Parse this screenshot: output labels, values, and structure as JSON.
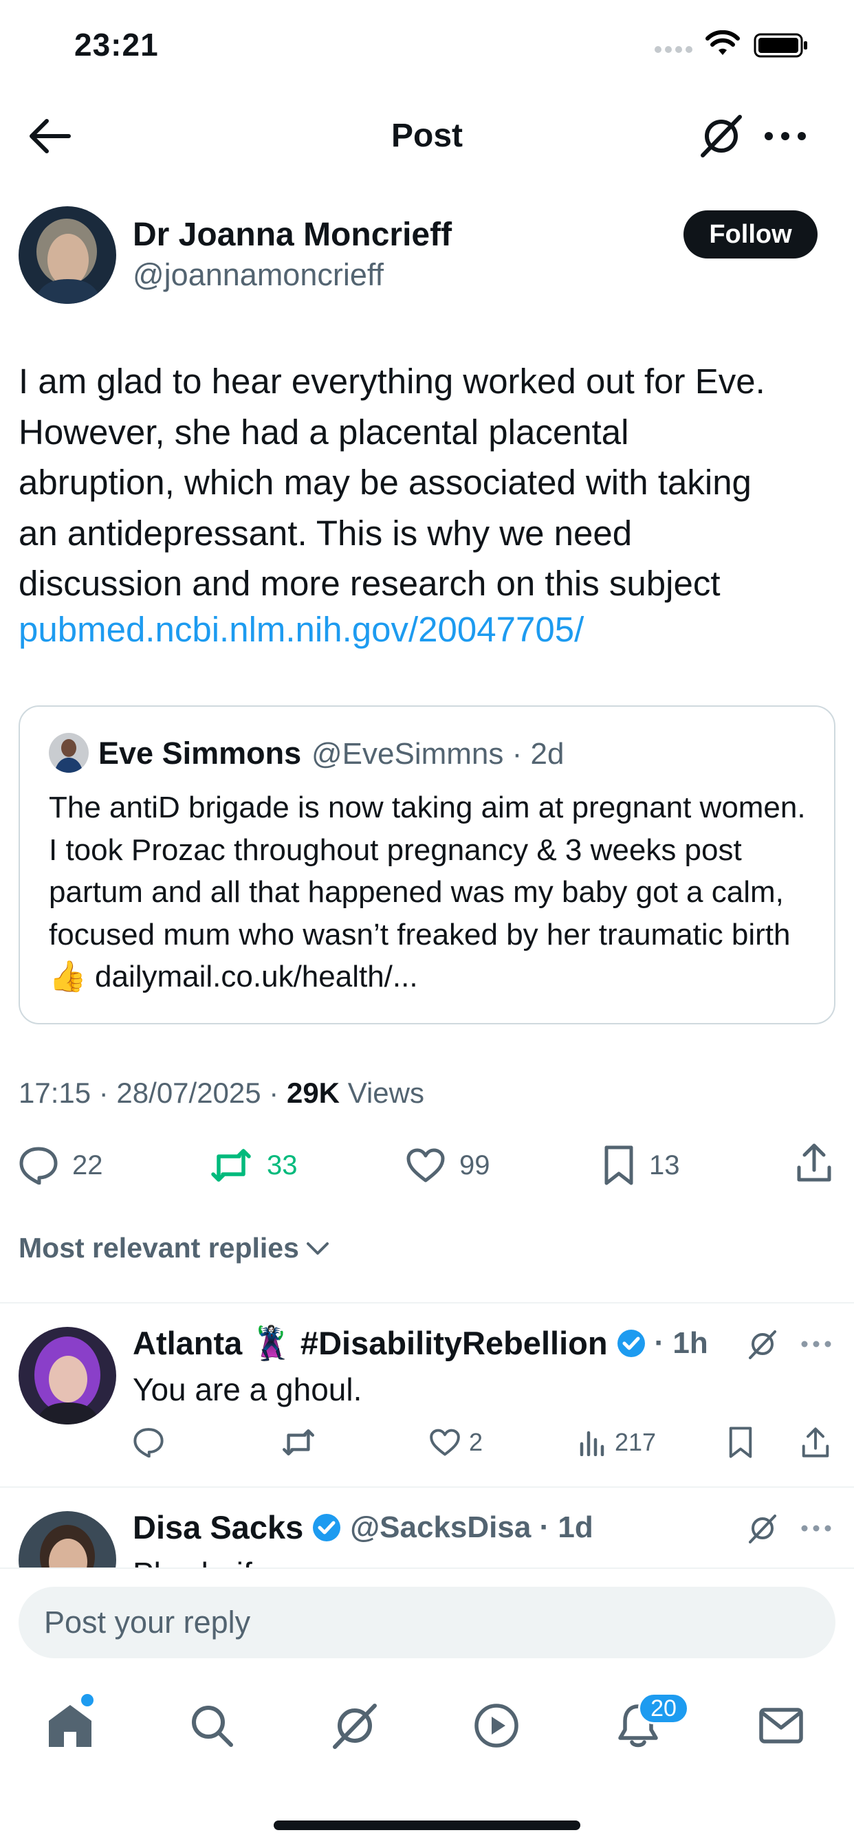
{
  "status_bar": {
    "time": "23:21"
  },
  "header": {
    "title": "Post"
  },
  "post": {
    "author_name": "Dr Joanna Moncrieff",
    "author_handle": "@joannamoncrieff",
    "follow_label": "Follow",
    "text": "I am glad to hear everything worked out for Eve.\nHowever, she had a placental placental\nabruption, which may be associated with taking\nan antidepressant.   This is why we need\ndiscussion and more research on this subject",
    "link": "pubmed.ncbi.nlm.nih.gov/20047705/",
    "quote": {
      "name": "Eve Simmons",
      "meta": "@EveSimmns · 2d",
      "text": "The antiD brigade is now taking aim at pregnant women. I took Prozac throughout pregnancy & 3 weeks post partum and all that happened was my baby got a calm, focused mum who wasn’t freaked by her traumatic birth 👍 dailymail.co.uk/health/..."
    },
    "timestamp": "17:15 · 28/07/2025 · ",
    "views_count": "29K",
    "views_label": " Views",
    "stats": {
      "replies": "22",
      "reposts": "33",
      "likes": "99",
      "bookmarks": "13"
    }
  },
  "replies_filter": "Most relevant replies",
  "replies": [
    {
      "name": "Atlanta 🦹‍♀️ #DisabilityRebellion",
      "meta": "· 1h",
      "text": "You are a ghoul.",
      "likes": "2",
      "views": "217"
    },
    {
      "name": "Disa Sacks",
      "meta": "@SacksDisa · 1d",
      "text": "Pls clarify"
    }
  ],
  "composer": {
    "placeholder": "Post your reply"
  },
  "tab_bar": {
    "notifications_badge": "20"
  },
  "colors": {
    "accent": "#1d9bf0",
    "repost": "#00ba7c",
    "text": "#0f1419",
    "muted": "#536471"
  }
}
